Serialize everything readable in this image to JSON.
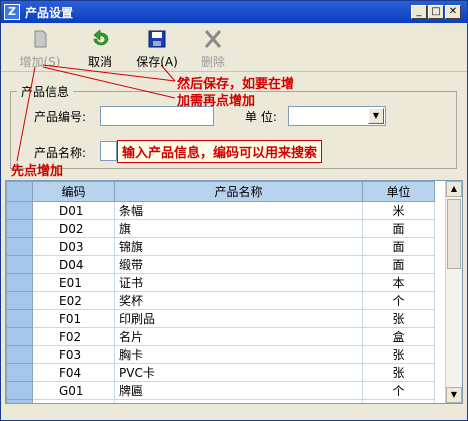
{
  "window": {
    "title": "产品设置",
    "app_icon": "Z",
    "minimize": "_",
    "maximize": "□",
    "close": "✕"
  },
  "toolbar": {
    "add_label": "增加(S)",
    "cancel_label": "取消",
    "save_label": "保存(A)",
    "delete_label": "删除"
  },
  "form": {
    "legend": "产品信息",
    "code_label": "产品编号:",
    "code_value": "",
    "unit_label": "单 位:",
    "unit_value": "",
    "name_label": "产品名称:",
    "name_value": ""
  },
  "annotations": {
    "save_hint_line1": "然后保存，如要在增",
    "save_hint_line2": "加需再点增加",
    "name_hint": "输入产品信息，编码可以用来搜索",
    "add_hint": "先点增加"
  },
  "table": {
    "headers": [
      "编码",
      "产品名称",
      "单位"
    ],
    "rows": [
      {
        "code": "D01",
        "name": "条幅",
        "unit": "米"
      },
      {
        "code": "D02",
        "name": "旗",
        "unit": "面"
      },
      {
        "code": "D03",
        "name": "锦旗",
        "unit": "面"
      },
      {
        "code": "D04",
        "name": "缎带",
        "unit": "面"
      },
      {
        "code": "E01",
        "name": "证书",
        "unit": "本"
      },
      {
        "code": "E02",
        "name": "奖杯",
        "unit": "个"
      },
      {
        "code": "F01",
        "name": "印刷品",
        "unit": "张"
      },
      {
        "code": "F02",
        "name": "名片",
        "unit": "盒"
      },
      {
        "code": "F03",
        "name": "胸卡",
        "unit": "张"
      },
      {
        "code": "F04",
        "name": "PVC卡",
        "unit": "张"
      },
      {
        "code": "G01",
        "name": "牌匾",
        "unit": "个"
      }
    ],
    "new_row_marker": "*"
  },
  "colors": {
    "titlebar": "#0a3fbe",
    "annotation": "#d00000",
    "header_bg": "#b7d3ee"
  }
}
